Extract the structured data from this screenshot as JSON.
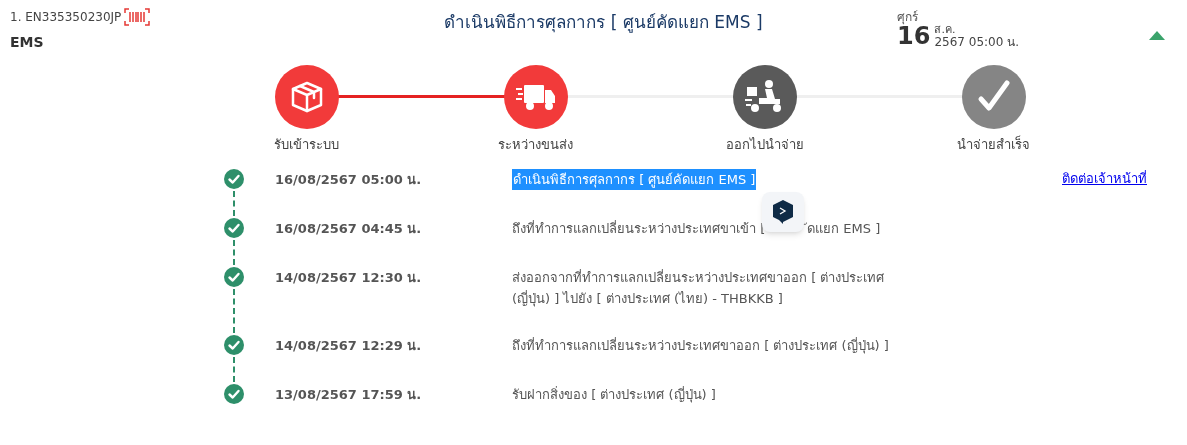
{
  "header": {
    "tracking": "1. EN335350230JP",
    "service": "EMS",
    "status_title": "ดำเนินพิธีการศุลกากร [ ศูนย์คัดแยก EMS ]",
    "weekday": "ศุกร์",
    "day": "16",
    "month": "ส.ค.",
    "year_time": "2567 05:00 น.",
    "expanded": true
  },
  "steps": [
    {
      "kind": "box",
      "label": "รับเข้าระบบ",
      "done": true,
      "color": "#f23a3a"
    },
    {
      "kind": "truck",
      "label": "ระหว่างขนส่ง",
      "done": true,
      "color": "#f23a3a"
    },
    {
      "kind": "scooter",
      "label": "ออกไปนำจ่าย",
      "done": false,
      "color": "#5a5a5a"
    },
    {
      "kind": "check",
      "label": "นำจ่ายสำเร็จ",
      "done": false,
      "color": "#858585"
    }
  ],
  "events": [
    {
      "time": "16/08/2567 05:00 น.",
      "description": "ดำเนินพิธีการศุลกากร [ ศูนย์คัดแยก EMS ]",
      "highlighted": true,
      "link": "ติดต่อเจ้าหน้าที่"
    },
    {
      "time": "16/08/2567 04:45 น.",
      "description": "ถึงที่ทำการแลกเปลี่ยนระหว่างประเทศขาเข้า [",
      "description_after_overlay": "ัดแยก EMS ]",
      "highlighted": false
    },
    {
      "time": "14/08/2567 12:30 น.",
      "description": "ส่งออกจากที่ทำการแลกเปลี่ยนระหว่างประเทศขาออก [ ต่างประเทศ (ญี่ปุ่น) ] ไปยัง [ ต่างประเทศ (ไทย) - THBKKB ]",
      "highlighted": false
    },
    {
      "time": "14/08/2567 12:29 น.",
      "description": "ถึงที่ทำการแลกเปลี่ยนระหว่างประเทศขาออก [ ต่างประเทศ (ญี่ปุ่น) ]",
      "highlighted": false
    },
    {
      "time": "13/08/2567 17:59 น.",
      "description": "รับฝากสิ่งของ [ ต่างประเทศ (ญี่ปุ่น) ]",
      "highlighted": false
    }
  ]
}
